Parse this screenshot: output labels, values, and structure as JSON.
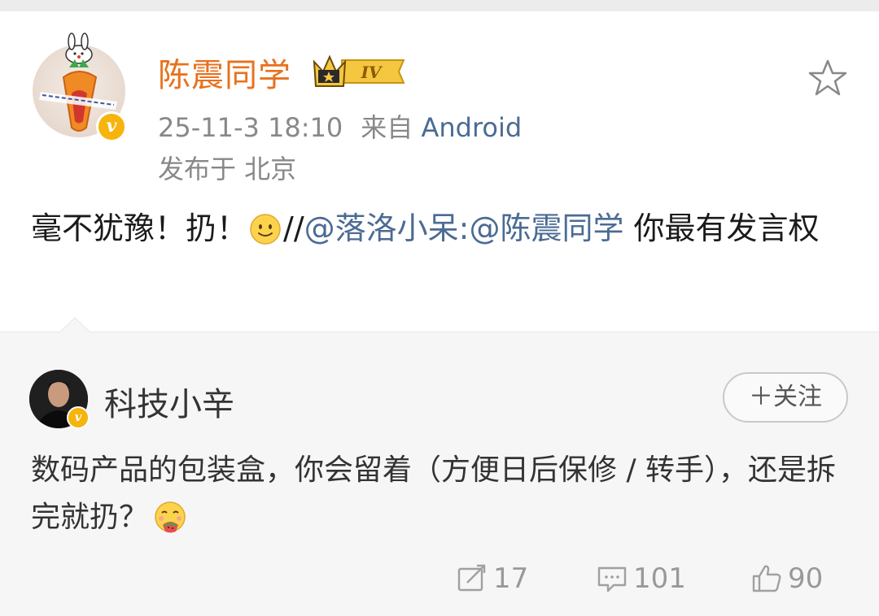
{
  "post": {
    "author": "陈震同学",
    "level_badge": "IV",
    "timestamp": "25-11-3 18:10",
    "source_prefix": "来自",
    "source_device": "Android",
    "location": "发布于 北京",
    "text_part1": "毫不犹豫！扔！",
    "text_slashes": "//",
    "mention1": "@落洛小呆",
    "colon": ":",
    "mention2": "@陈震同学",
    "text_part2": " 你最有发言权",
    "icons": [
      "verified-v-icon",
      "crown-level-icon",
      "star-icon",
      "smile-emoji"
    ]
  },
  "retweet": {
    "author": "科技小辛",
    "follow_label": "＋关注",
    "text": "数码产品的包装盒，你会留着（方便日后保修 / 转手），还是拆完就扔？",
    "icons": [
      "verified-v-icon",
      "eating-emoji"
    ],
    "stats": {
      "reposts": "17",
      "comments": "101",
      "likes": "90"
    },
    "stat_icons": [
      "repost-icon",
      "comment-icon",
      "like-icon"
    ]
  },
  "colors": {
    "author_name": "#e8711d",
    "mention": "#4b6b93",
    "meta": "#888888",
    "verified_badge": "#f6b40c",
    "retweet_bg": "#f6f6f6"
  }
}
